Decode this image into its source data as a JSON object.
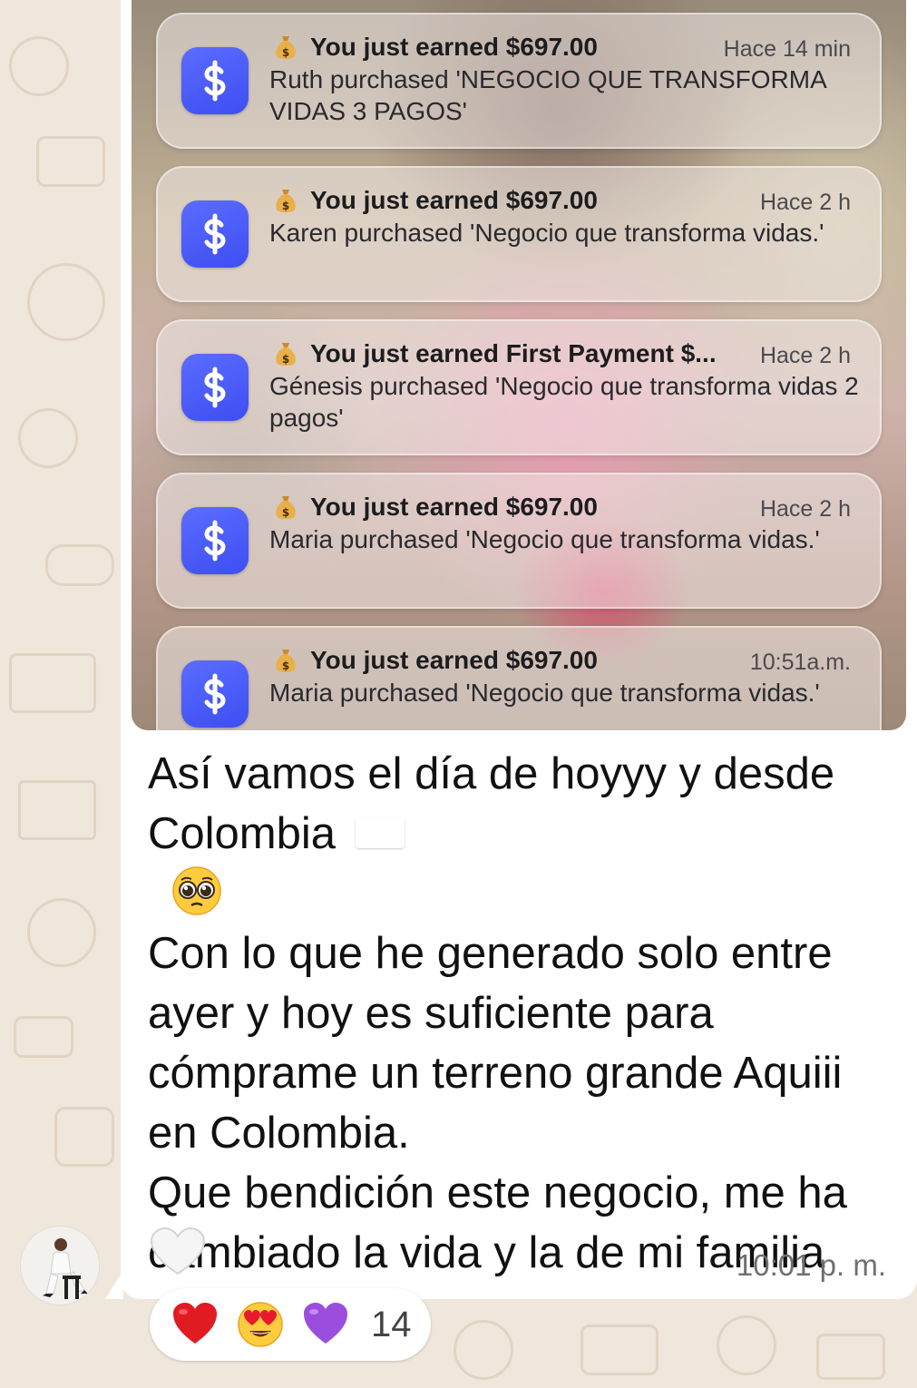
{
  "notifications": [
    {
      "title": "You just earned $697.00",
      "time": "Hace 14 min",
      "body": "Ruth purchased 'NEGOCIO QUE TRANSFORMA VIDAS 3 PAGOS'"
    },
    {
      "title": "You just earned $697.00",
      "time": "Hace 2 h",
      "body": "Karen purchased 'Negocio que transforma vidas.'"
    },
    {
      "title": "You just earned First Payment $...",
      "time": "Hace 2 h",
      "body": "Génesis purchased 'Negocio que transforma vidas 2 pagos'"
    },
    {
      "title": "You just earned $697.00",
      "time": "Hace 2 h",
      "body": "Maria purchased 'Negocio que transforma vidas.'"
    },
    {
      "title": "You just earned $697.00",
      "time": "10:51a.m.",
      "body": "Maria purchased 'Negocio que transforma vidas.'"
    }
  ],
  "message": {
    "line1": "Así vamos el día de hoyyy y desde",
    "line2": "Colombia",
    "paragraph2": "Con lo que he generado solo entre ayer y hoy es suficiente para cómprame un terreno grande Aquiii en Colombia.",
    "paragraph3": "Que bendición este negocio, me ha cambiado la vida y la de mi familia",
    "timestamp": "10:01 p. m."
  },
  "reactions": {
    "emojis": [
      "red-heart",
      "heart-eyes",
      "purple-heart"
    ],
    "count": "14"
  },
  "colors": {
    "app_icon": "#4453f5",
    "bubble": "#ffffff",
    "wallpaper": "#efe7dc"
  }
}
